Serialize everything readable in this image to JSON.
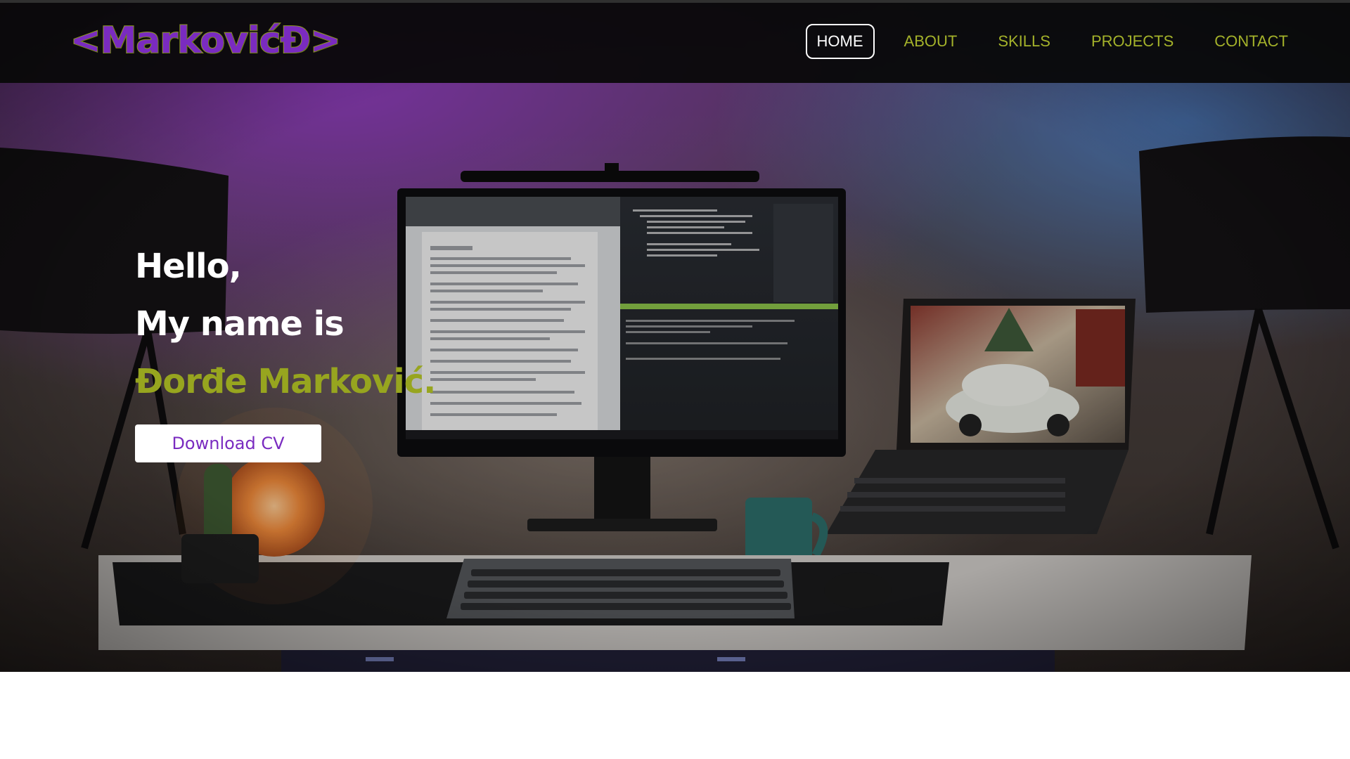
{
  "header": {
    "logo": "<MarkovićĐ>",
    "nav": [
      {
        "label": "HOME",
        "active": true
      },
      {
        "label": "ABOUT",
        "active": false
      },
      {
        "label": "SKILLS",
        "active": false
      },
      {
        "label": "PROJECTS",
        "active": false
      },
      {
        "label": "CONTACT",
        "active": false
      }
    ]
  },
  "hero": {
    "greeting": "Hello,",
    "intro": "My name is",
    "name": "Đorđe Marković.",
    "cv_button": "Download CV",
    "background_image": "desk-setup-photo"
  },
  "colors": {
    "accent_green": "#97a51f",
    "accent_purple": "#7a2bc0",
    "header_bg": "#080808",
    "text_white": "#ffffff"
  }
}
